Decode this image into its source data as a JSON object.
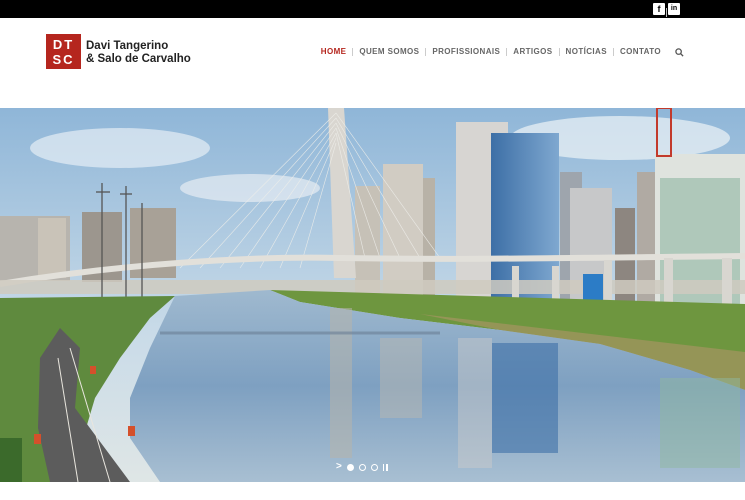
{
  "topbar": {
    "social": [
      {
        "name": "facebook-icon",
        "glyph": "f"
      },
      {
        "name": "linkedin-icon",
        "glyph": "in"
      }
    ]
  },
  "logo": {
    "mark_line1": "DT",
    "mark_line2": "SC",
    "name_line1": "Davi Tangerino",
    "name_line2": "& Salo de Carvalho"
  },
  "nav": {
    "items": [
      "HOME",
      "QUEM SOMOS",
      "PROFISSIONAIS",
      "ARTIGOS",
      "NOTÍCIAS",
      "CONTATO"
    ],
    "active_index": 0
  },
  "slider": {
    "slide_count": 3,
    "active_slide": 1
  },
  "colors": {
    "brand": "#b5261e",
    "topbar": "#000000"
  }
}
